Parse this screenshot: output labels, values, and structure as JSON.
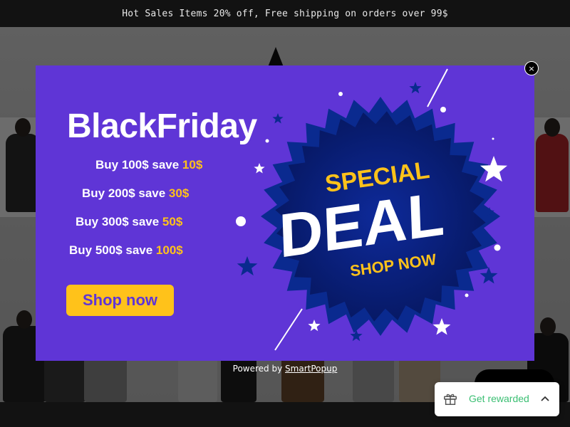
{
  "announcement": {
    "text": "Hot Sales Items 20% off, Free shipping on orders over 99$"
  },
  "popup": {
    "title": "BlackFriday",
    "offers": [
      {
        "text": "Buy 100$ save ",
        "amount": "10$"
      },
      {
        "text": "Buy 200$ save ",
        "amount": "30$"
      },
      {
        "text": "Buy 300$ save ",
        "amount": "50$"
      },
      {
        "text": "Buy 500$ save ",
        "amount": "100$"
      }
    ],
    "shop_button": "Shop now",
    "badge": {
      "line1": "SPECIAL",
      "line2": "DEAL",
      "line3": "SHOP NOW"
    },
    "close_symbol": "×",
    "colors": {
      "background": "#5f35d6",
      "accent": "#ffc21a",
      "badge": "#0a1f7a"
    }
  },
  "powered_by": {
    "prefix": "Powered by ",
    "link": "SmartPopup"
  },
  "rewards_widget": {
    "label": "Get rewarded",
    "icon": "gift-icon",
    "toggle_icon": "chevron-up-icon"
  }
}
